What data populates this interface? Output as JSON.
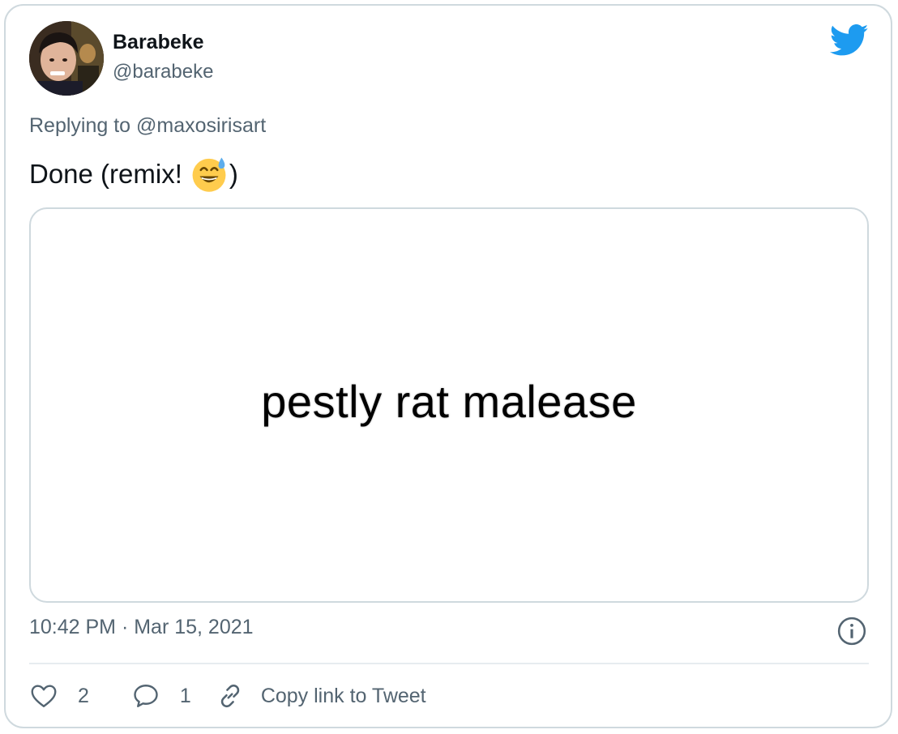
{
  "tweet": {
    "author_name": "Barabeke",
    "author_handle": "@barabeke",
    "replying_prefix": "Replying to",
    "replying_to": "@maxosirisart",
    "text": "Done (remix!",
    "text_suffix": ")",
    "emoji": "grinning-face-with-sweat",
    "media_text": "pestly rat malease",
    "timestamp": "10:42 PM · Mar 15, 2021",
    "likes": "2",
    "replies": "1",
    "copy_link_label": "Copy link to Tweet"
  },
  "colors": {
    "accent": "#1d9bf0",
    "secondary_text": "#536471",
    "border": "#cfd9de"
  },
  "icons": {
    "brand": "twitter-bird-icon",
    "info": "info-icon",
    "like": "heart-icon",
    "reply": "speech-bubble-icon",
    "copy": "link-icon"
  }
}
